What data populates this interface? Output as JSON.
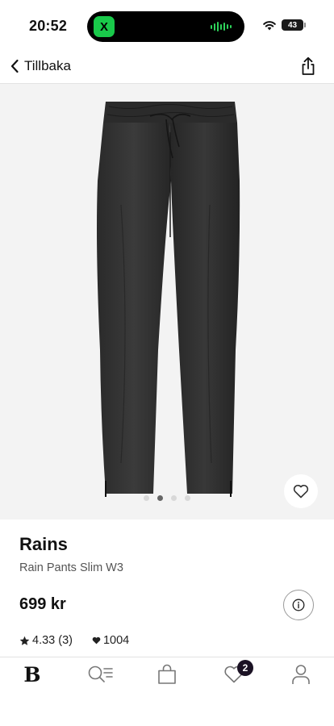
{
  "status_bar": {
    "time": "20:52",
    "battery_level": "43",
    "icons": [
      "wifi-icon",
      "battery-icon"
    ],
    "island_app": "X"
  },
  "nav": {
    "back_label": "Tillbaka",
    "share_icon": "share-icon"
  },
  "gallery": {
    "image_count": 4,
    "active_index": 1,
    "favorite_icon": "heart-outline-icon"
  },
  "product": {
    "brand": "Rains",
    "name": "Rain Pants Slim W3",
    "price": "699 kr",
    "rating": "4.33 (3)",
    "likes": "1004"
  },
  "tabbar": {
    "items": [
      {
        "name": "home",
        "label": "B",
        "icon": "brand-logo-icon"
      },
      {
        "name": "search",
        "label": "",
        "icon": "search-list-icon"
      },
      {
        "name": "bag",
        "label": "",
        "icon": "shopping-bag-icon"
      },
      {
        "name": "favorites",
        "label": "",
        "icon": "heart-icon",
        "badge": "2"
      },
      {
        "name": "profile",
        "label": "",
        "icon": "person-icon"
      }
    ]
  },
  "colors": {
    "accent": "#1b1224",
    "image_background": "#f3f3f3",
    "island_app": "#19c94a"
  }
}
